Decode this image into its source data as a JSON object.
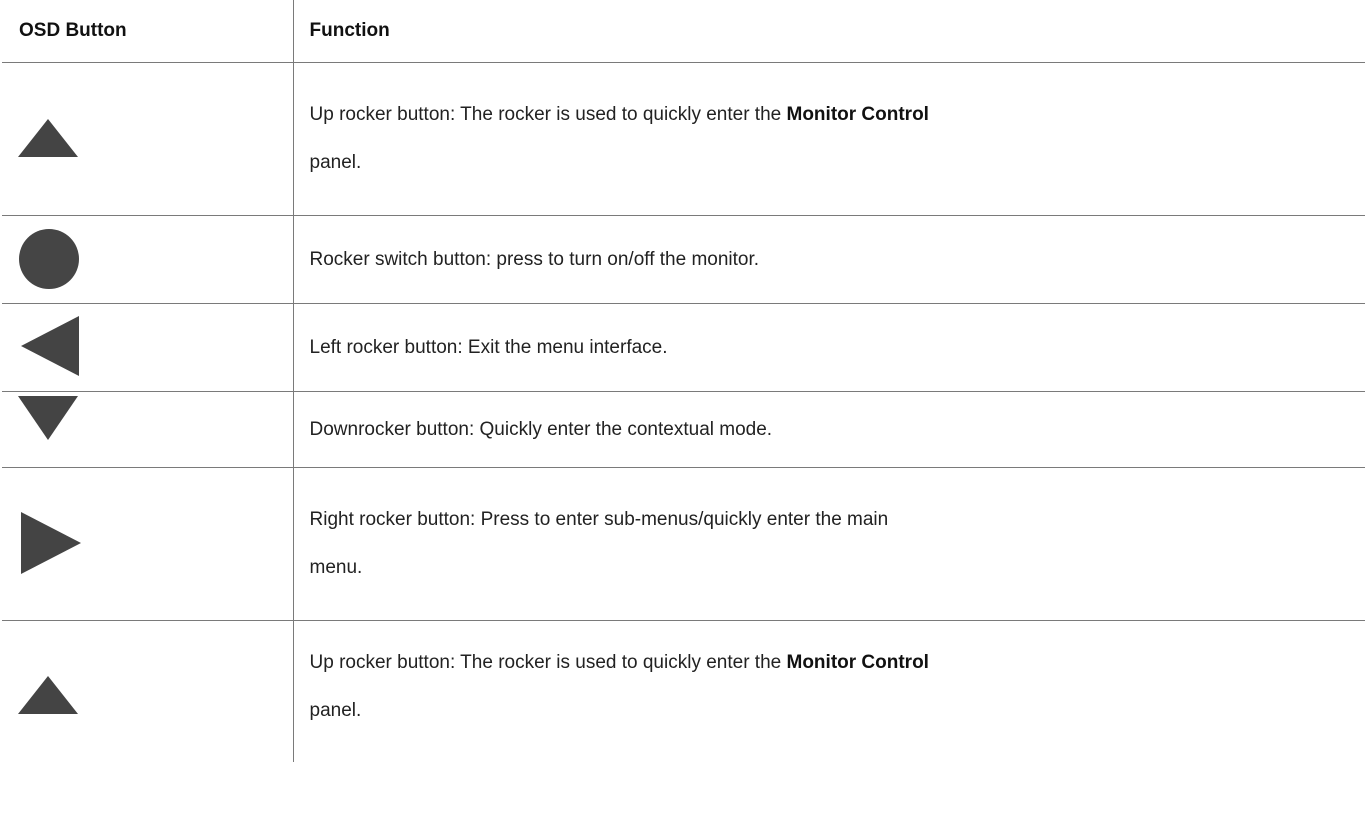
{
  "table": {
    "headers": {
      "osd_button": "OSD Button",
      "function": "Function"
    },
    "rows": [
      {
        "icon": "up-triangle-icon",
        "text_before": "Up rocker button: The rocker is used to quickly enter the ",
        "bold": "Monitor Control",
        "text_after": "panel."
      },
      {
        "icon": "circle-icon",
        "text": "Rocker switch button: press to turn on/off the monitor."
      },
      {
        "icon": "left-triangle-icon",
        "text": "Left rocker button: Exit the menu interface."
      },
      {
        "icon": "down-triangle-icon",
        "text": "Downrocker button: Quickly enter the contextual mode."
      },
      {
        "icon": "right-triangle-icon",
        "line1": "Right rocker button: Press to enter sub-menus/quickly enter the main",
        "line2": "menu."
      },
      {
        "icon": "up-triangle-icon",
        "text_before": "Up rocker button: The rocker is used to quickly enter the ",
        "bold": "Monitor Control",
        "text_after": "panel."
      }
    ]
  },
  "colors": {
    "icon": "#444444",
    "border": "#7a7a7a",
    "text": "#222222"
  }
}
